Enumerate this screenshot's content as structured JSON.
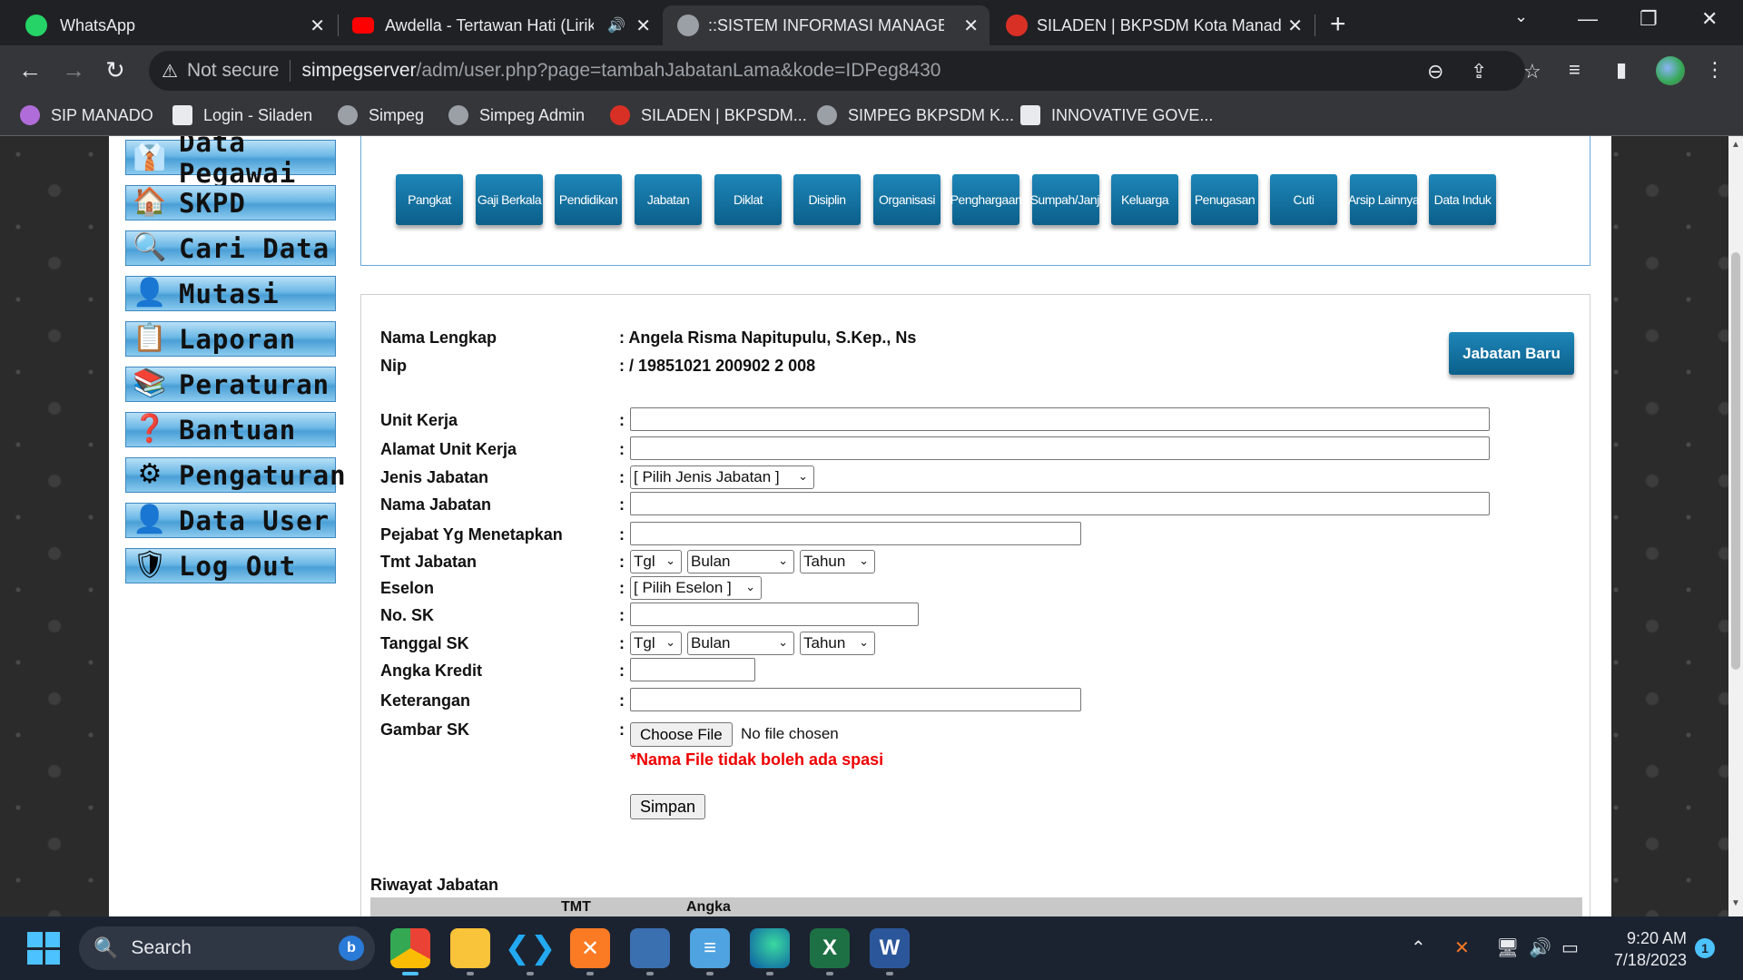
{
  "browser": {
    "tabs": [
      {
        "title": "WhatsApp",
        "icon": "whatsapp-icon",
        "color": "#25d366"
      },
      {
        "title": "Awdella - Tertawan Hati (Lirik",
        "icon": "youtube-icon",
        "color": "#ff0000"
      },
      {
        "title": "::SISTEM INFORMASI MANAGEM",
        "icon": "globe-icon",
        "color": "#9aa0a6"
      },
      {
        "title": "SILADEN | BKPSDM Kota Manado",
        "icon": "siladen-icon",
        "color": "#d93025"
      }
    ],
    "not_secure": "Not secure",
    "url_host": "simpegserver",
    "url_path": "/adm/user.php?page=tambahJabatanLama&kode=IDPeg8430",
    "bookmarks": [
      "SIP MANADO",
      "Login - Siladen",
      "Simpeg",
      "Simpeg Admin",
      "SILADEN | BKPSDM...",
      "SIMPEG BKPSDM K...",
      "INNOVATIVE GOVE..."
    ]
  },
  "menu": [
    {
      "label": "Data Pegawai",
      "icon": "employee-icon",
      "glyph": "👔"
    },
    {
      "label": "SKPD",
      "icon": "house-icon",
      "glyph": "🏠"
    },
    {
      "label": "Cari Data",
      "icon": "magnifier-icon",
      "glyph": "🔍"
    },
    {
      "label": "Mutasi",
      "icon": "person-icon",
      "glyph": "👤"
    },
    {
      "label": "Laporan",
      "icon": "clipboard-icon",
      "glyph": "📋"
    },
    {
      "label": "Peraturan",
      "icon": "books-icon",
      "glyph": "📚"
    },
    {
      "label": "Bantuan",
      "icon": "help-icon",
      "glyph": "❓"
    },
    {
      "label": "Pengaturan",
      "icon": "gear-icon",
      "glyph": "⚙"
    },
    {
      "label": "Data User",
      "icon": "user-icon",
      "glyph": "👤"
    },
    {
      "label": "Log Out",
      "icon": "shield-icon",
      "glyph": "🛡"
    }
  ],
  "tabs": [
    "Pangkat",
    "Gaji Berkala",
    "Pendidikan",
    "Jabatan",
    "Diklat",
    "Disiplin",
    "Organisasi",
    "Penghargaan",
    "Sumpah/Janji",
    "Keluarga",
    "Penugasan",
    "Cuti",
    "Arsip Lainnya",
    "Data Induk"
  ],
  "form": {
    "nama_label": "Nama Lengkap",
    "nama_value": ": Angela Risma Napitupulu, S.Kep., Ns",
    "nip_label": "Nip",
    "nip_value": ": / 19851021 200902 2 008",
    "jabatan_baru": "Jabatan Baru",
    "colon": ":",
    "unit_kerja": "Unit Kerja",
    "alamat_unit_kerja": "Alamat Unit Kerja",
    "jenis_jabatan": "Jenis Jabatan",
    "jenis_jabatan_select": "[ Pilih Jenis Jabatan ]",
    "nama_jabatan": "Nama Jabatan",
    "pejabat": "Pejabat Yg Menetapkan",
    "tmt_jabatan": "Tmt Jabatan",
    "tgl": "Tgl",
    "bulan": "Bulan",
    "tahun": "Tahun",
    "eselon": "Eselon",
    "eselon_select": "[ Pilih Eselon ]",
    "no_sk": "No. SK",
    "tanggal_sk": "Tanggal SK",
    "angka_kredit": "Angka Kredit",
    "keterangan": "Keterangan",
    "gambar_sk": "Gambar SK",
    "choose_file": "Choose File",
    "no_file": "No file chosen",
    "warning": "*Nama File tidak boleh ada spasi",
    "simpan": "Simpan"
  },
  "riwayat": {
    "title": "Riwayat Jabatan",
    "headers": [
      "TMT",
      "Angka"
    ]
  },
  "taskbar": {
    "search": "Search",
    "time": "9:20 AM",
    "date": "7/18/2023",
    "notifications": "1"
  }
}
